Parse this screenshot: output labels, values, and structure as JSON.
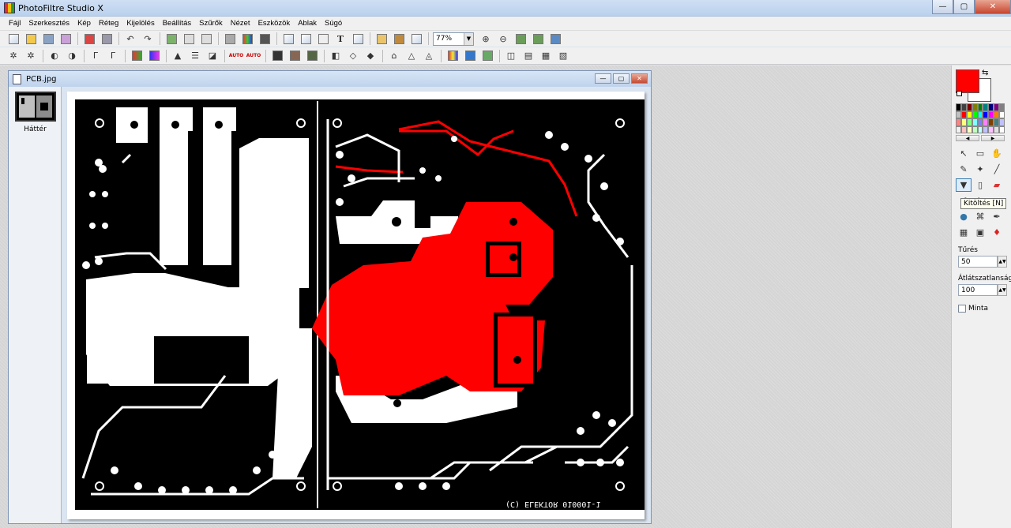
{
  "app": {
    "title": "PhotoFiltre Studio X"
  },
  "menu": [
    "Fájl",
    "Szerkesztés",
    "Kép",
    "Réteg",
    "Kijelölés",
    "Beállítás",
    "Szűrők",
    "Nézet",
    "Eszközök",
    "Ablak",
    "Súgó"
  ],
  "toolbar": {
    "zoom_value": "77%"
  },
  "document": {
    "title": "PCB.jpg",
    "layer_label": "Háttér",
    "pcb_text": "(C) ELEKTOR  010001-1"
  },
  "colors": {
    "foreground": "#ff0000",
    "background": "#ffffff",
    "fill": "#ff0000"
  },
  "tools_panel": {
    "tooltip": "Kitöltés [N]",
    "tolerance_label": "Tűrés",
    "tolerance_value": "50",
    "opacity_label": "Átlátszatlanság",
    "opacity_value": "100",
    "pattern_label": "Minta"
  },
  "palette": [
    "#000000",
    "#404040",
    "#800000",
    "#808000",
    "#008000",
    "#008080",
    "#000080",
    "#800080",
    "#808080",
    "#c0c0c0",
    "#ff0000",
    "#ffff00",
    "#00ff00",
    "#00ffff",
    "#0000ff",
    "#ff00ff",
    "#ff8000",
    "#ffffff",
    "#ff8080",
    "#ffff80",
    "#80ff80",
    "#80ffff",
    "#8080ff",
    "#ff80ff",
    "#804000",
    "#408080",
    "#c0c0ff",
    "#f0f0f0",
    "#ffc0c0",
    "#ffffc0",
    "#c0ffc0",
    "#c0ffff",
    "#c0c0ff",
    "#ffc0ff",
    "#e0e0e0",
    "#ffffff"
  ]
}
